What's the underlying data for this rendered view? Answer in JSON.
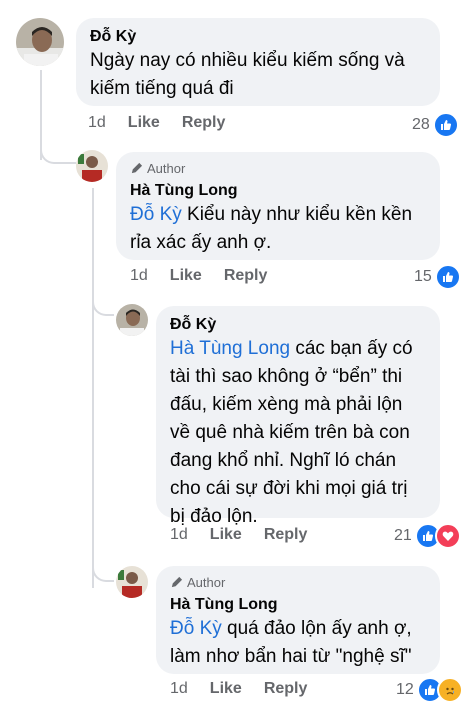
{
  "comments": [
    {
      "author": "Đỗ Kỳ",
      "text": "Ngày nay có nhiều kiểu kiếm sống và kiếm tiếng quá đi",
      "age": "1d",
      "like_label": "Like",
      "reply_label": "Reply",
      "reaction_count": "28",
      "reactions": [
        "like-icon"
      ]
    },
    {
      "badge": "Author",
      "author": "Hà Tùng Long",
      "mention": "Đỗ Kỳ",
      "text": "Kiểu này như kiểu kền kền rỉa xác ấy anh ợ.",
      "age": "1d",
      "like_label": "Like",
      "reply_label": "Reply",
      "reaction_count": "15",
      "reactions": [
        "like-icon"
      ]
    },
    {
      "author": "Đỗ Kỳ",
      "mention": "Hà Tùng Long",
      "text": "các bạn ấy có tài thì sao không ở “bển” thi đấu, kiếm xèng mà phải lộn về quê nhà kiếm trên bà con đang khổ nhỉ. Nghĩ ló chán cho cái sự đời khi mọi giá trị bị đảo lộn.",
      "age": "1d",
      "like_label": "Like",
      "reply_label": "Reply",
      "reaction_count": "21",
      "reactions": [
        "like-icon",
        "love-icon"
      ]
    },
    {
      "badge": "Author",
      "author": "Hà Tùng Long",
      "mention": "Đỗ Kỳ",
      "text": "quá đảo lộn ấy anh ợ, làm nhơ bẩn hai từ \"nghệ sĩ\"",
      "age": "1d",
      "like_label": "Like",
      "reply_label": "Reply",
      "reaction_count": "12",
      "reactions": [
        "like-icon",
        "sad-icon"
      ]
    }
  ]
}
